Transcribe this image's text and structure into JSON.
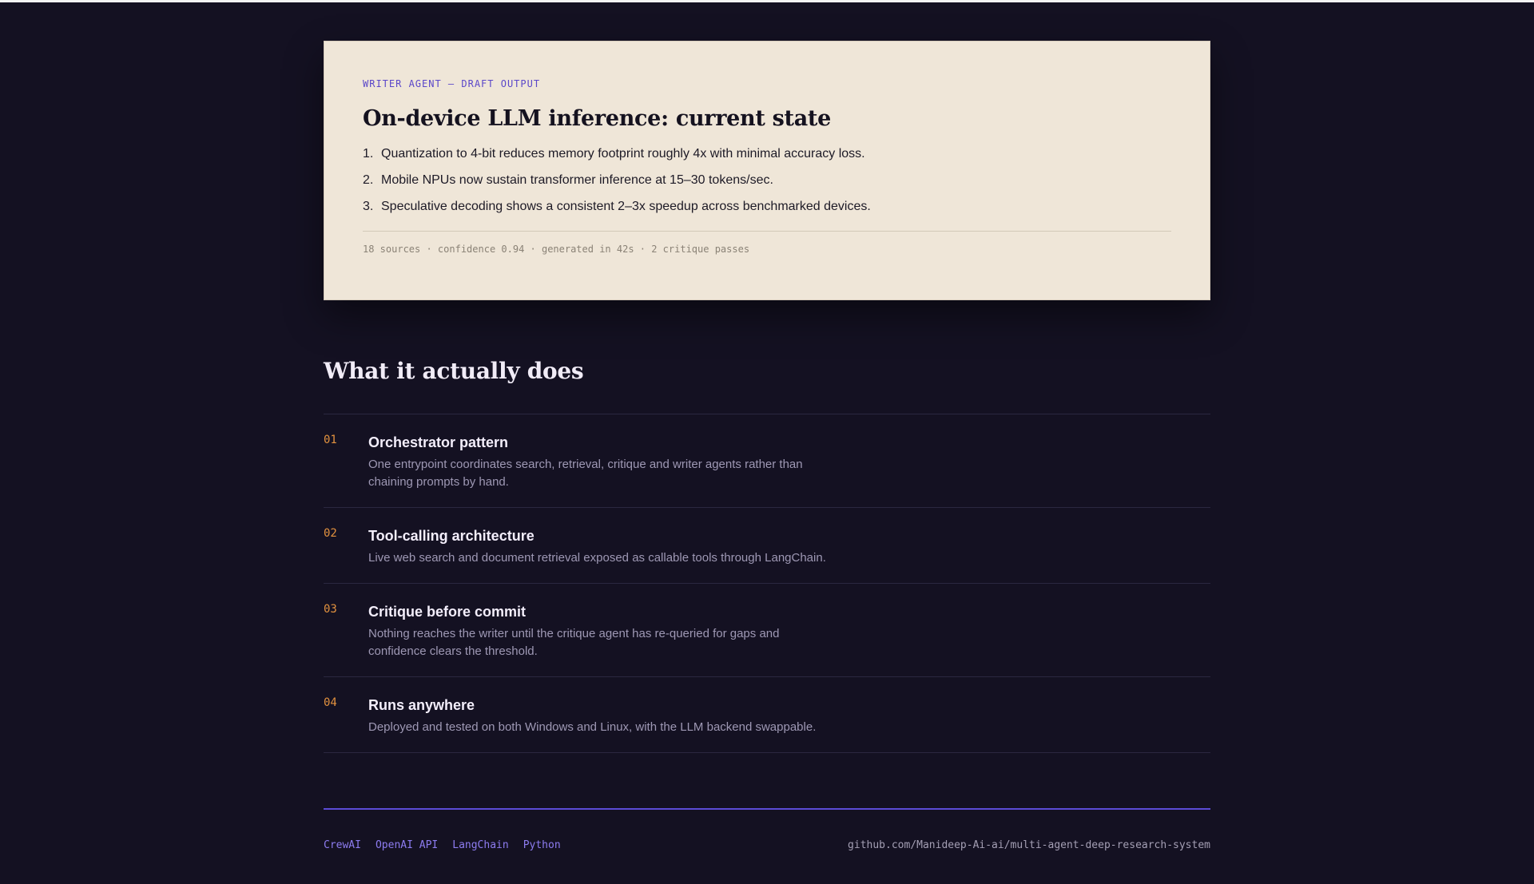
{
  "draft_card": {
    "kicker": "WRITER AGENT — DRAFT OUTPUT",
    "title": "On-device LLM inference: current state",
    "items": [
      {
        "num": "1.",
        "text": "Quantization to 4-bit reduces memory footprint roughly 4x with minimal accuracy loss."
      },
      {
        "num": "2.",
        "text": "Mobile NPUs now sustain transformer inference at 15–30 tokens/sec."
      },
      {
        "num": "3.",
        "text": "Speculative decoding shows a consistent 2–3x speedup across benchmarked devices."
      }
    ],
    "meta": "18 sources · confidence 0.94 · generated in 42s · 2 critique passes"
  },
  "features_section": {
    "title": "What it actually does",
    "items": [
      {
        "num": "01",
        "title": "Orchestrator pattern",
        "desc": "One entrypoint coordinates search, retrieval, critique and writer agents rather than chaining prompts by hand."
      },
      {
        "num": "02",
        "title": "Tool-calling architecture",
        "desc": "Live web search and document retrieval exposed as callable tools through LangChain."
      },
      {
        "num": "03",
        "title": "Critique before commit",
        "desc": "Nothing reaches the writer until the critique agent has re-queried for gaps and confidence clears the threshold."
      },
      {
        "num": "04",
        "title": "Runs anywhere",
        "desc": "Deployed and tested on both Windows and Linux, with the LLM backend swappable."
      }
    ]
  },
  "footer": {
    "tags": [
      "CrewAI",
      "OpenAI API",
      "LangChain",
      "Python"
    ],
    "repo": "github.com/Manideep-Ai-ai/multi-agent-deep-research-system"
  },
  "colors": {
    "background": "#141122",
    "card_background": "#efe6d8",
    "accent_purple": "#5c4bd6",
    "accent_orange": "#e3923f"
  }
}
